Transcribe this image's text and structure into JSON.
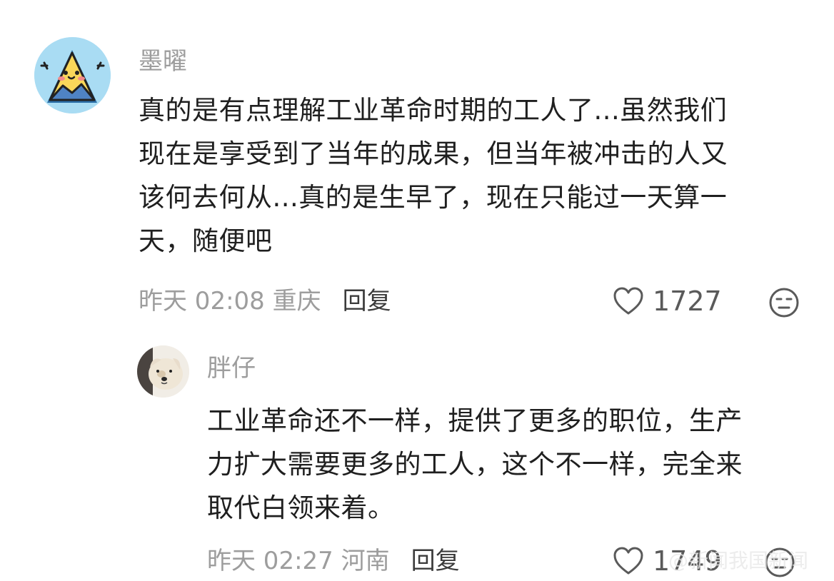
{
  "comments": [
    {
      "username": "墨曜",
      "lines": [
        "真的是有点理解工业革命时期的工人了...虽然我们",
        "现在是享受到了当年的成果，但当年被冲击的人又",
        "该何去何从...真的是生早了，现在只能过一天算一",
        "天，随便吧"
      ],
      "meta": "昨天 02:08 重庆",
      "reply_label": "回复",
      "likes": "1727",
      "avatar_icon": "cartoon-mountain-avatar",
      "like_icon": "heart-outline-icon",
      "reaction_icon": "neutral-face-icon"
    },
    {
      "username": "胖仔",
      "lines": [
        "工业革命还不一样，提供了更多的职位，生产",
        "力扩大需要更多的工人，这个不一样，完全来",
        "取代白领来着。"
      ],
      "meta": "昨天 02:27 河南",
      "reply_label": "回复",
      "likes": "1749",
      "avatar_icon": "dog-photo-avatar",
      "like_icon": "heart-outline-icon",
      "reaction_icon": "neutral-face-icon"
    }
  ],
  "watermark": "@新闻我国新闻",
  "colors": {
    "username": "#9d9d9d",
    "text": "#1f1f1f",
    "reply": "#3b3b3b",
    "avatar_bg_1": "#a9dcf3"
  }
}
